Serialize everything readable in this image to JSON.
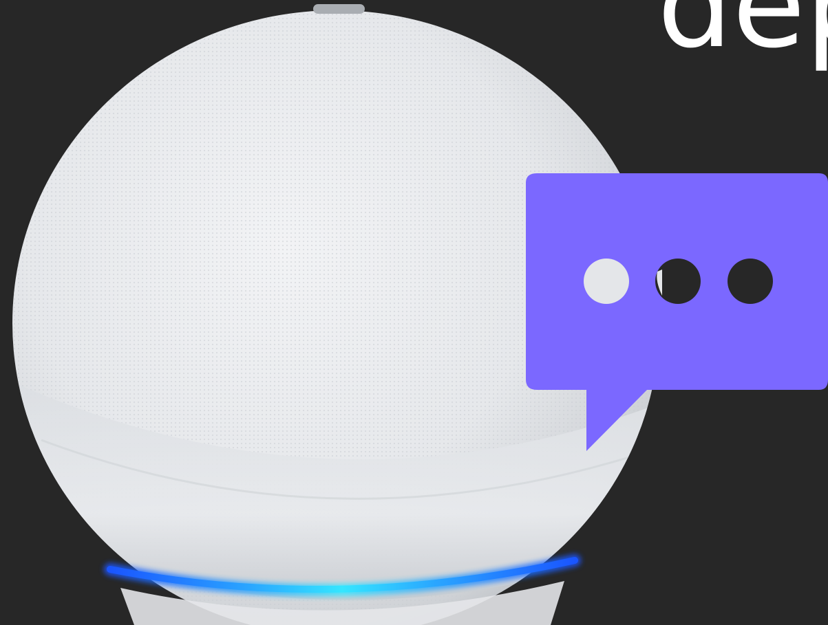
{
  "headline": {
    "text": "dep"
  },
  "colors": {
    "background": "#272727",
    "headline_text": "#ffffff",
    "speaker_body": "#e9ebee",
    "speaker_shadow": "#bfc3c8",
    "light_ring_center": "#35e6ff",
    "light_ring_edge": "#1a55ff",
    "speech_bubble": "#7b68ff",
    "bubble_dot": "#272727"
  },
  "icons": {
    "speech_bubble": "speech-bubble-icon",
    "ellipsis": "ellipsis-icon"
  }
}
